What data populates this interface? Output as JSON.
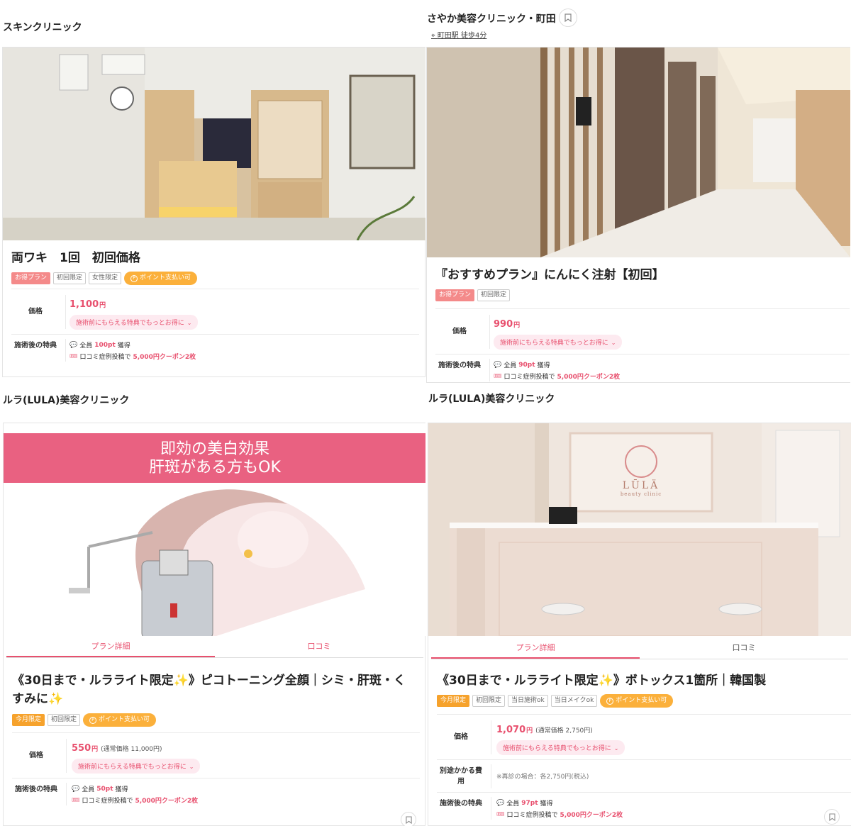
{
  "panels": [
    {
      "clinic_name": "スキンクリニック",
      "plan_title": "両ワキ　1回　初回価格",
      "tags": [
        "お得プラン",
        "初回限定",
        "女性限定"
      ],
      "point_tag": "ポイント支払い可",
      "price_label": "価格",
      "price": "1,100",
      "yen": "円",
      "perk_button": "施術前にもらえる特典でもっとお得に",
      "after_label": "施術後の特典",
      "points_prefix": "全員",
      "points_value": "100pt",
      "points_suffix": "獲得",
      "coupon_prefix": "口コミ症例投稿で",
      "coupon_value": "5,000円クーポン2枚"
    },
    {
      "clinic_name": "さやか美容クリニック・町田",
      "access": "町田駅 徒歩4分",
      "plan_title": "『おすすめプラン』にんにく注射【初回】",
      "tags": [
        "お得プラン",
        "初回限定"
      ],
      "price_label": "価格",
      "price": "990",
      "yen": "円",
      "perk_button": "施術前にもらえる特典でもっとお得に",
      "after_label": "施術後の特典",
      "points_prefix": "全員",
      "points_value": "90pt",
      "points_suffix": "獲得",
      "coupon_prefix": "口コミ症例投稿で",
      "coupon_value": "5,000円クーポン2枚"
    },
    {
      "clinic_name": "ルラ(LULA)美容クリニック",
      "hero_line1": "即効の美白効果",
      "hero_line2": "肝斑がある方もOK",
      "tab_details": "プラン詳細",
      "tab_reviews": "口コミ",
      "plan_title": "《30日まで・ルラライト限定✨》ピコトーニング全顔｜シミ・肝斑・くすみに✨",
      "tags": [
        "今月限定",
        "初回限定"
      ],
      "point_tag": "ポイント支払い可",
      "price_label": "価格",
      "price": "550",
      "yen": "円",
      "regular_price": "(通常価格 11,000円)",
      "perk_button": "施術前にもらえる特典でもっとお得に",
      "after_label": "施術後の特典",
      "points_prefix": "全員",
      "points_value": "50pt",
      "points_suffix": "獲得",
      "coupon_prefix": "口コミ症例投稿で",
      "coupon_value": "5,000円クーポン2枚"
    },
    {
      "clinic_name": "ルラ(LULA)美容クリニック",
      "logo_text": "LŪLÄ",
      "logo_sub": "beauty clinic",
      "tab_details": "プラン詳細",
      "tab_reviews": "口コミ",
      "plan_title": "《30日まで・ルラライト限定✨》ボトックス1箇所｜韓国製",
      "tags": [
        "今月限定",
        "初回限定",
        "当日施術ok",
        "当日メイクok"
      ],
      "point_tag": "ポイント支払い可",
      "price_label": "価格",
      "price": "1,070",
      "yen": "円",
      "regular_price": "(通常価格 2,750円)",
      "perk_button": "施術前にもらえる特典でもっとお得に",
      "extra_label": "別途かかる費用",
      "extra_note": "※再診の場合：各2,750円(税込)",
      "after_label": "施術後の特典",
      "points_prefix": "全員",
      "points_value": "97pt",
      "points_suffix": "獲得",
      "coupon_prefix": "口コミ症例投稿で",
      "coupon_value": "5,000円クーポン2枚"
    }
  ]
}
